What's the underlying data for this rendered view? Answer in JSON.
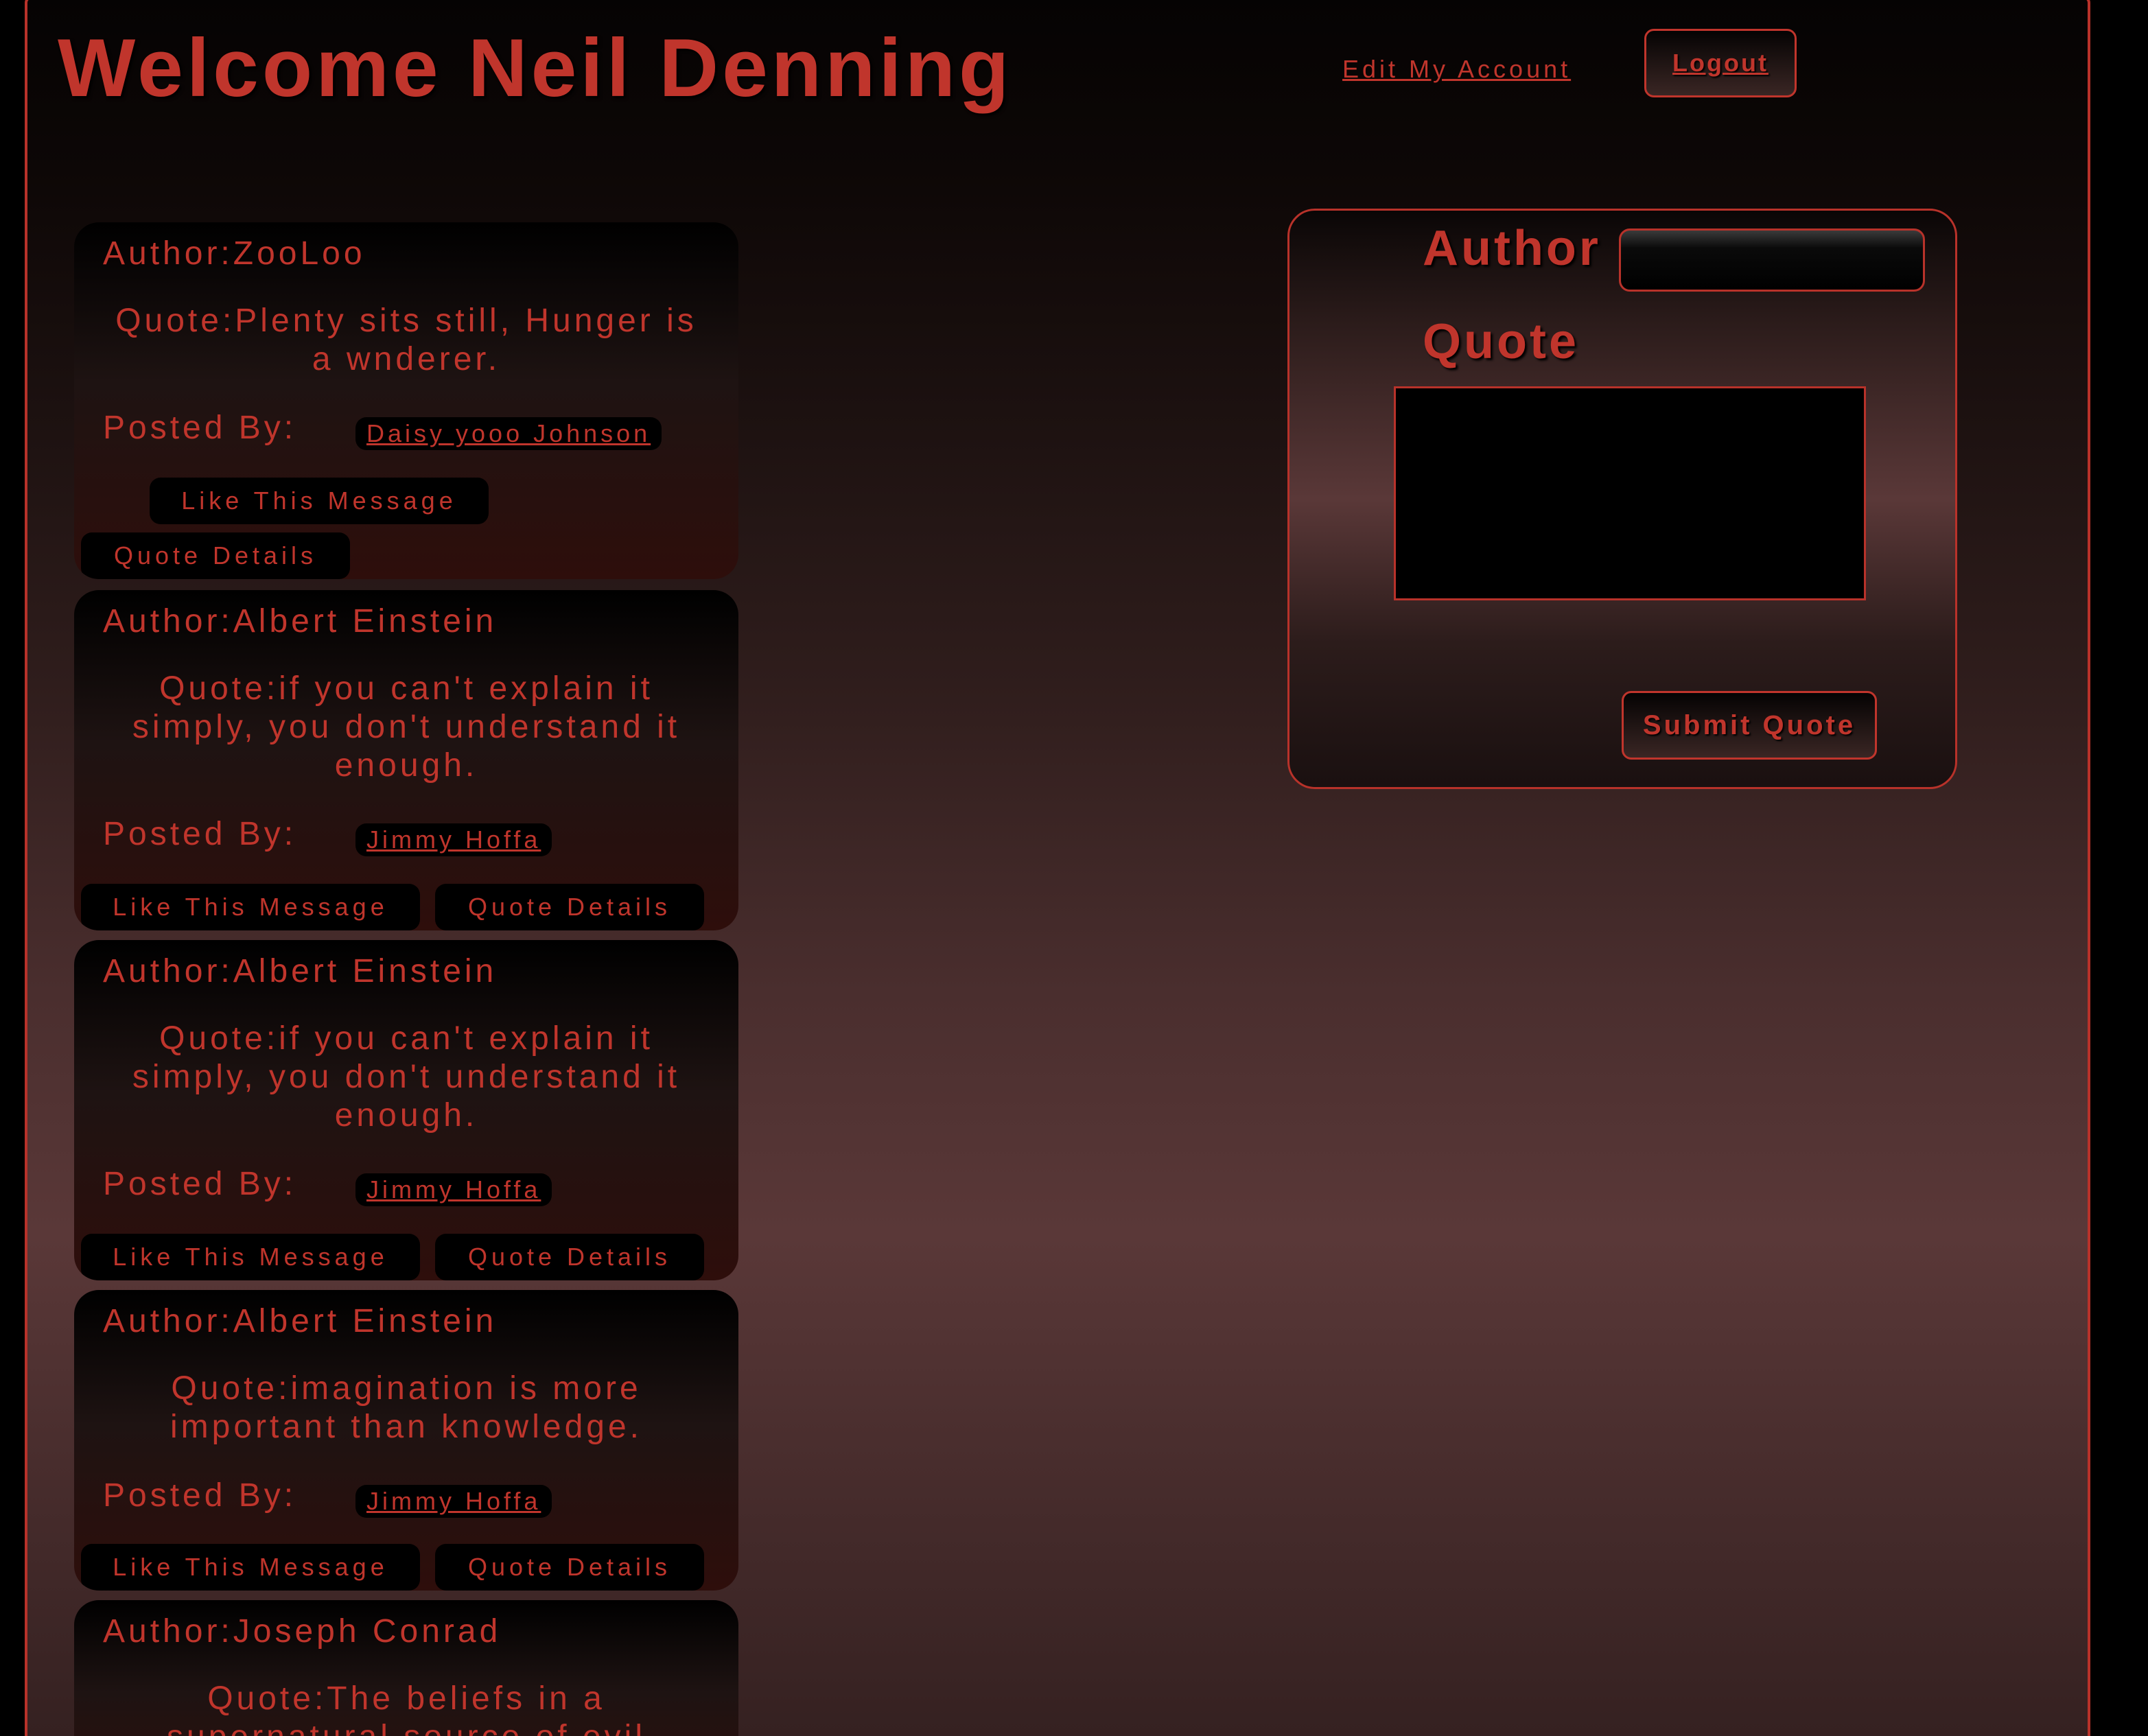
{
  "header": {
    "title": "Welcome Neil Denning",
    "edit_account": "Edit My Account",
    "logout": "Logout"
  },
  "quotes": [
    {
      "author": "Author:ZooLoo",
      "quote": "Quote:Plenty sits still, Hunger is a wnderer.",
      "posted_by_label": "Posted By:",
      "poster": "Daisy yooo Johnson",
      "like_label": "Like This Message",
      "details_label": "Quote Details"
    },
    {
      "author": "Author:Albert Einstein",
      "quote": "Quote:if you can't explain it simply, you don't understand it enough.",
      "posted_by_label": "Posted By:",
      "poster": "Jimmy Hoffa",
      "like_label": "Like This Message",
      "details_label": "Quote Details"
    },
    {
      "author": "Author:Albert Einstein",
      "quote": "Quote:if you can't explain it simply, you don't understand it enough.",
      "posted_by_label": "Posted By:",
      "poster": "Jimmy Hoffa",
      "like_label": "Like This Message",
      "details_label": "Quote Details"
    },
    {
      "author": "Author:Albert Einstein",
      "quote": "Quote:imagination is more important than knowledge.",
      "posted_by_label": "Posted By:",
      "poster": "Jimmy Hoffa",
      "like_label": "Like This Message",
      "details_label": "Quote Details"
    },
    {
      "author": "Author:Joseph Conrad",
      "quote": "Quote:The beliefs in a supernatural source of evil"
    }
  ],
  "form": {
    "author_label": "Author",
    "author_value": "",
    "quote_label": "Quote",
    "quote_value": "",
    "submit_label": "Submit Quote"
  },
  "colors": {
    "accent": "#c0352c",
    "background_dark": "#050303",
    "background_mid": "#5a3838"
  }
}
